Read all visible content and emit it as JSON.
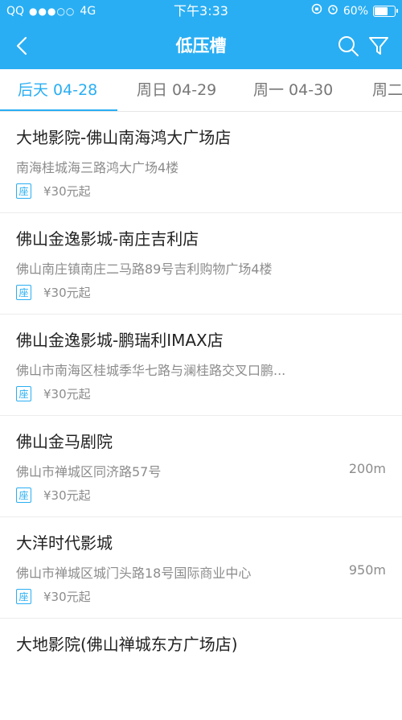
{
  "status_bar": {
    "carrier": "QQ",
    "signal": "●●●○○",
    "network": "4G",
    "time": "下午3:33",
    "battery": "60%"
  },
  "nav": {
    "title": "低压槽",
    "back_icon": "back-arrow-icon",
    "search_icon": "search-icon",
    "filter_icon": "filter-icon",
    "accent_color": "#29aef3"
  },
  "tabs": [
    {
      "label": "后天 04-28",
      "active": true
    },
    {
      "label": "周日 04-29",
      "active": false
    },
    {
      "label": "周一 04-30",
      "active": false
    },
    {
      "label": "周二",
      "active": false
    }
  ],
  "cinemas": [
    {
      "name": "大地影院-佛山南海鸿大广场店",
      "address": "南海桂城海三路鸿大广场4楼",
      "distance": "",
      "seat_badge": "座",
      "price": "¥30元起"
    },
    {
      "name": "佛山金逸影城-南庄吉利店",
      "address": "佛山南庄镇南庄二马路89号吉利购物广场4楼",
      "distance": "",
      "seat_badge": "座",
      "price": "¥30元起"
    },
    {
      "name": "佛山金逸影城-鹏瑞利IMAX店",
      "address": "佛山市南海区桂城季华七路与澜桂路交叉口鹏...",
      "distance": "",
      "seat_badge": "座",
      "price": "¥30元起"
    },
    {
      "name": "佛山金马剧院",
      "address": "佛山市禅城区同济路57号",
      "distance": "200m",
      "seat_badge": "座",
      "price": "¥30元起"
    },
    {
      "name": "大洋时代影城",
      "address": "佛山市禅城区城门头路18号国际商业中心",
      "distance": "950m",
      "seat_badge": "座",
      "price": "¥30元起"
    },
    {
      "name": "大地影院(佛山禅城东方广场店)",
      "address": "",
      "distance": "",
      "seat_badge": "",
      "price": ""
    }
  ]
}
